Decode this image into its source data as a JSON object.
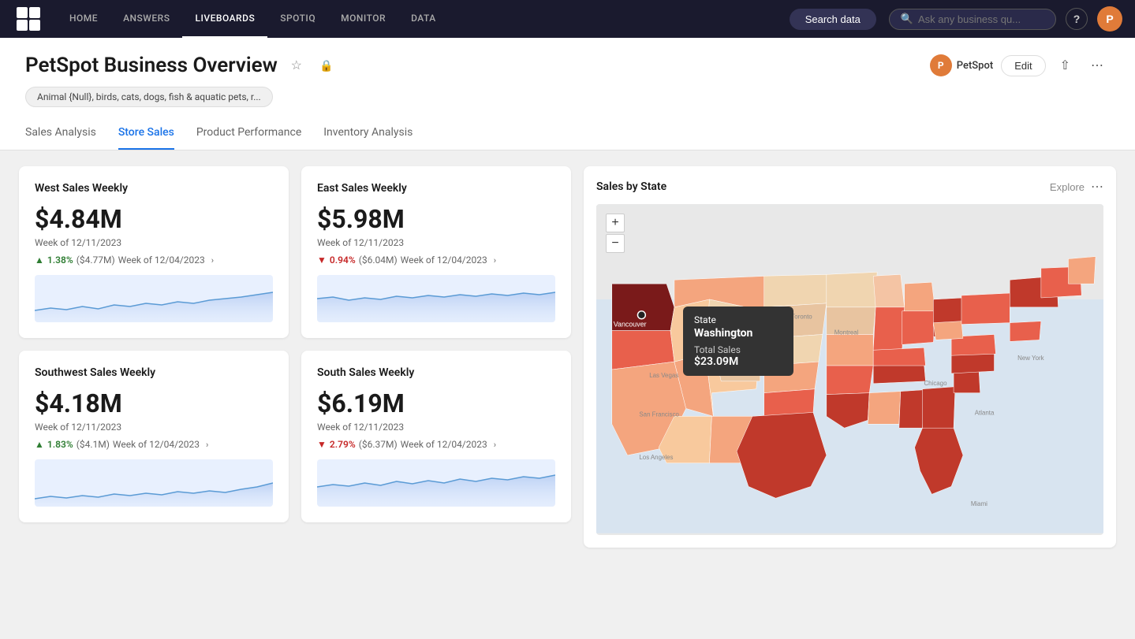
{
  "topnav": {
    "logo_alt": "ThoughtSpot",
    "links": [
      {
        "label": "HOME",
        "active": false
      },
      {
        "label": "ANSWERS",
        "active": false
      },
      {
        "label": "LIVEBOARDS",
        "active": true
      },
      {
        "label": "SPOTIQ",
        "active": false
      },
      {
        "label": "MONITOR",
        "active": false
      },
      {
        "label": "DATA",
        "active": false
      }
    ],
    "search_btn_label": "Search data",
    "ai_placeholder": "Ask any business qu...",
    "help_icon": "?",
    "avatar_label": "P"
  },
  "page": {
    "title": "PetSpot Business Overview",
    "owner_label": "PetSpot",
    "owner_avatar": "P",
    "edit_btn": "Edit",
    "filter_pill": "Animal {Null}, birds, cats, dogs, fish & aquatic pets, r..."
  },
  "tabs": [
    {
      "label": "Sales Analysis",
      "active": false
    },
    {
      "label": "Store Sales",
      "active": true
    },
    {
      "label": "Product Performance",
      "active": false
    },
    {
      "label": "Inventory Analysis",
      "active": false
    }
  ],
  "cards": [
    {
      "id": "west",
      "title": "West Sales Weekly",
      "value": "$4.84M",
      "week": "Week of 12/11/2023",
      "delta_dir": "up",
      "delta_pct": "1.38%",
      "delta_amt": "($4.77M)",
      "delta_week": "Week of 12/04/2023"
    },
    {
      "id": "east",
      "title": "East Sales Weekly",
      "value": "$5.98M",
      "week": "Week of 12/11/2023",
      "delta_dir": "down",
      "delta_pct": "0.94%",
      "delta_amt": "($6.04M)",
      "delta_week": "Week of 12/04/2023"
    },
    {
      "id": "southwest",
      "title": "Southwest Sales Weekly",
      "value": "$4.18M",
      "week": "Week of 12/11/2023",
      "delta_dir": "up",
      "delta_pct": "1.83%",
      "delta_amt": "($4.1M)",
      "delta_week": "Week of 12/04/2023"
    },
    {
      "id": "south",
      "title": "South Sales Weekly",
      "value": "$6.19M",
      "week": "Week of 12/11/2023",
      "delta_dir": "down",
      "delta_pct": "2.79%",
      "delta_amt": "($6.37M)",
      "delta_week": "Week of 12/04/2023"
    }
  ],
  "map": {
    "title": "Sales by State",
    "explore_btn": "Explore",
    "tooltip": {
      "state_label": "State",
      "state_name": "Washington",
      "sales_label": "Total Sales",
      "sales_value": "$23.09M"
    },
    "zoom_plus": "+",
    "zoom_minus": "−"
  }
}
